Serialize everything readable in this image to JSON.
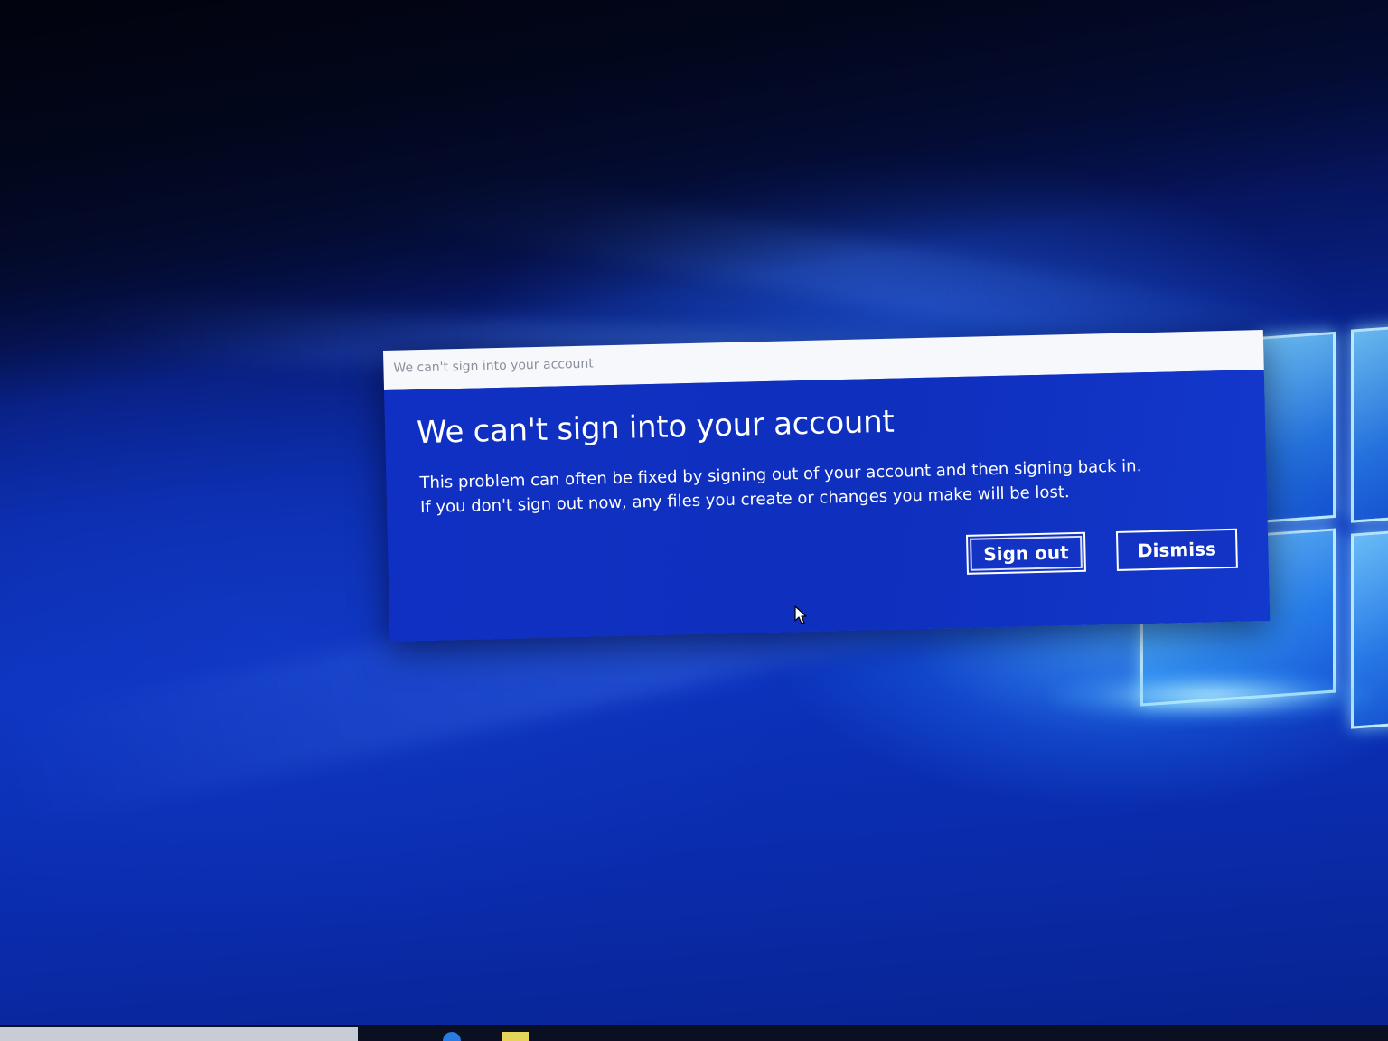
{
  "dialog": {
    "window_title": "We can't sign into your account",
    "heading": "We can't sign into your account",
    "message_line1": "This problem can often be fixed by signing out of your account and then signing back in.",
    "message_line2": "If you don't sign out now, any files you create or changes you make will be lost.",
    "primary_button": "Sign out",
    "secondary_button": "Dismiss"
  },
  "colors": {
    "dialog_background": "#1030c4",
    "titlebar_background": "#f7f8fb",
    "text": "#ffffff"
  },
  "icons": {
    "cursor": "arrow-pointer-icon",
    "wallpaper_logo": "windows-logo"
  }
}
